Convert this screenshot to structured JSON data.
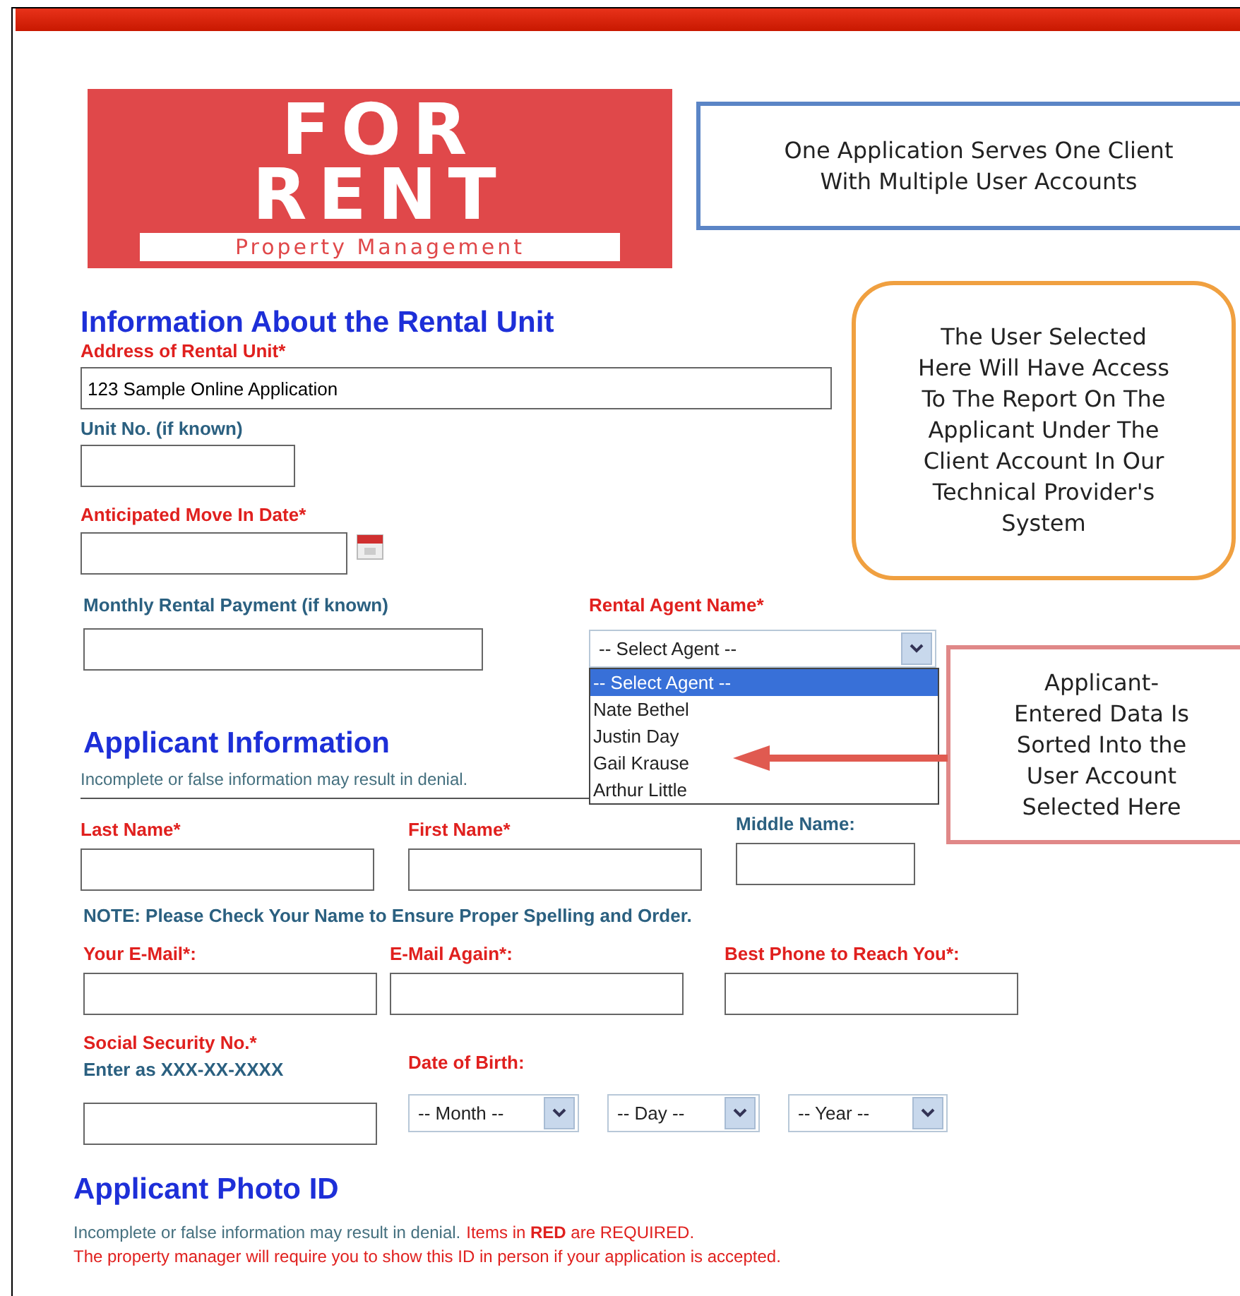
{
  "logo": {
    "line1": "FOR",
    "line2": "RENT",
    "tagline": "Property Management"
  },
  "callouts": [
    {
      "kind": "box",
      "lines": [
        "One Application Serves One Client",
        "With Multiple User Accounts"
      ]
    },
    {
      "kind": "rounded",
      "lines": [
        "The User Selected",
        "Here Will Have Access",
        "To The Report On The",
        "Applicant Under The",
        "Client Account In Our",
        "Technical Provider's",
        "System"
      ]
    },
    {
      "kind": "pointer",
      "lines": [
        "Applicant-",
        "Entered Data Is",
        "Sorted Into the",
        "User Account",
        "Selected Here"
      ]
    }
  ],
  "rental_unit": {
    "heading": "Information About the Rental Unit",
    "address": {
      "label": "Address of Rental Unit*",
      "required": true,
      "value": "123 Sample Online Application"
    },
    "unit": {
      "label": "Unit No. (if known)",
      "required": false
    },
    "move_in": {
      "label": "Anticipated Move In Date*",
      "required": true
    },
    "payment": {
      "label": "Monthly Rental Payment (if known)",
      "required": false
    },
    "agent": {
      "label": "Rental Agent Name*",
      "required": true,
      "value": "-- Select Agent --",
      "expanded": true,
      "options": [
        {
          "label": "-- Select Agent --",
          "selected": true
        },
        {
          "label": "Nate Bethel",
          "selected": false
        },
        {
          "label": "Justin Day",
          "selected": false
        },
        {
          "label": "Gail Krause",
          "selected": false
        },
        {
          "label": "Arthur Little",
          "selected": false
        }
      ]
    }
  },
  "applicant": {
    "heading": "Applicant Information",
    "note": "Incomplete or false information may result in denial.",
    "names": [
      {
        "label": "Last Name*",
        "required": true
      },
      {
        "label": "First Name*",
        "required": true
      },
      {
        "label": "Middle Name:",
        "required": false
      }
    ],
    "name_note": "NOTE: Please Check Your Name to Ensure Proper Spelling and Order.",
    "contacts": [
      {
        "label": "Your E-Mail*:",
        "required": true
      },
      {
        "label": "E-Mail Again*:",
        "required": true
      },
      {
        "label": "Best Phone to Reach You*:",
        "required": true
      }
    ],
    "ssn": {
      "label": "Social Security No.*",
      "required": true,
      "hint": "Enter as XXX-XX-XXXX"
    },
    "dob": {
      "label": "Date of Birth:",
      "required": true,
      "selects": [
        "-- Month --",
        "-- Day --",
        "-- Year --"
      ]
    }
  },
  "photo_id": {
    "heading": "Applicant Photo ID",
    "notes": [
      [
        {
          "text": "Incomplete or false information may result in denial.",
          "required": false
        },
        {
          "text": "Items in **RED** are REQUIRED.",
          "required": true
        }
      ],
      [
        {
          "text": "The property manager will require you to show this ID in person if your application is accepted.",
          "required": true
        }
      ]
    ]
  }
}
